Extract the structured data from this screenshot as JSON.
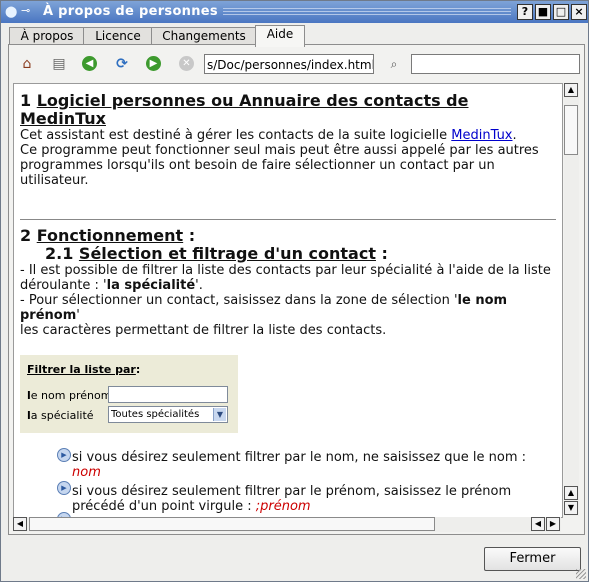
{
  "window": {
    "title": "À propos de personnes",
    "controls": [
      "?",
      "■",
      "□",
      "×"
    ]
  },
  "tabs": [
    {
      "label": "À propos",
      "active": false
    },
    {
      "label": "Licence",
      "active": false
    },
    {
      "label": "Changements",
      "active": false
    },
    {
      "label": "Aide",
      "active": true
    }
  ],
  "toolbar": {
    "icons": [
      "home-icon",
      "print-icon",
      "back-icon",
      "reload-icon",
      "forward-icon",
      "stop-icon",
      "search-icon"
    ],
    "url": "s/Doc/personnes/index.html",
    "search_value": ""
  },
  "doc": {
    "s1_num": "1 ",
    "s1_title": "Logiciel personnes ou Annuaire des contacts de MedinTux",
    "s1_p1_pre": "Cet assistant est destiné à gérer les contacts de la suite logicielle ",
    "s1_p1_link": "MedinTux",
    "s1_p1_post": ".",
    "s1_p2": "Ce programme peut fonctionner seul mais peut être aussi appelé par les autres programmes lorsqu'ils ont besoin de faire sélectionner un contact par un utilisateur.",
    "s2_num": "2 ",
    "s2_title": "Fonctionnement",
    "s2_colon": " :",
    "s21_num": "2.1 ",
    "s21_title": "Sélection et filtrage d'un contact",
    "s21_colon": " :",
    "l1_pre": "- Il est possible de filtrer la liste des contacts par leur spécialité à l'aide de la liste déroulante : '",
    "l1_bold": "la spécialité",
    "l1_post": "'.",
    "l2_pre": "- Pour sélectionner un contact, saisissez dans la zone de sélection '",
    "l2_bold": "le nom prénom",
    "l2_post": "'",
    "l3": "les caractères permettant de filtrer la liste des contacts.",
    "filter_title": "Filtrer la liste par",
    "filter_colon": " :",
    "filter_nom_first": "l",
    "filter_nom_rest": "e nom prénom",
    "filter_spec_first": "l",
    "filter_spec_rest": "a spécialité",
    "filter_nom_value": "",
    "filter_spec_value": "Toutes spécialités",
    "b1_text": "si vous désirez seulement filtrer par le nom, ne saisissez que le nom :",
    "b1_italic": "nom",
    "b2_text": "si vous désirez seulement filtrer par le prénom, saisissez le prénom précédé d'un point virgule :",
    "b2_italic": ";prénom"
  },
  "scroll": {
    "vertical_position": 0.0,
    "horizontal_position": 0.0
  },
  "footer": {
    "close_label": "Fermer"
  }
}
